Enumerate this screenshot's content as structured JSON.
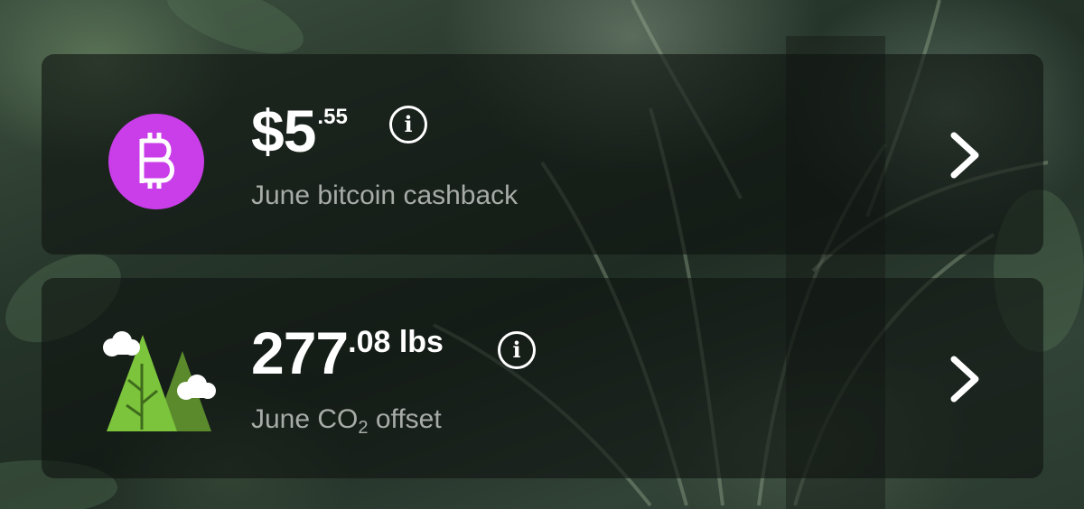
{
  "cashback_card": {
    "amount_main": "$5",
    "amount_cents": ".55",
    "info_label": "i",
    "caption": "June bitcoin cashback",
    "icon": "bitcoin-icon",
    "badge_color": "#c93ee8"
  },
  "co2_card": {
    "amount_main": "277",
    "amount_cents": ".08 lbs",
    "info_label": "i",
    "caption_prefix": "June CO",
    "caption_sub": "2",
    "caption_suffix": " offset",
    "icon": "trees-icon",
    "tree_color": "#7cc43c"
  }
}
